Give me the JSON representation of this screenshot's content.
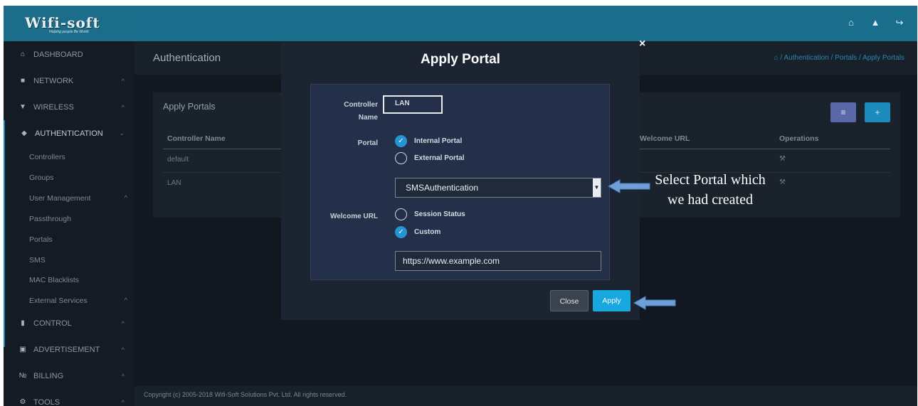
{
  "brand": {
    "logo_text": "Wifi-soft",
    "tagline": "Helping people Be World"
  },
  "header": {
    "icons": [
      "home-icon",
      "bell-icon",
      "logout-icon"
    ]
  },
  "sidebar": {
    "items": [
      {
        "label": "DASHBOARD",
        "icon": "home-icon"
      },
      {
        "label": "NETWORK",
        "icon": "monitor-icon"
      },
      {
        "label": "WIRELESS",
        "icon": "wifi-icon"
      },
      {
        "label": "AUTHENTICATION",
        "icon": "shield-icon"
      },
      {
        "label": "CONTROL",
        "icon": "database-icon"
      },
      {
        "label": "ADVERTISEMENT",
        "icon": "video-icon"
      },
      {
        "label": "BILLING",
        "icon": "billing-icon"
      },
      {
        "label": "TOOLS",
        "icon": "gear-icon"
      }
    ],
    "sub_items": [
      "Controllers",
      "Groups",
      "User Management",
      "Passthrough",
      "Portals",
      "SMS",
      "MAC Blacklists",
      "External Services"
    ]
  },
  "page": {
    "title": "Authentication",
    "breadcrumb": [
      "Authentication",
      "Portals",
      "Apply Portals"
    ]
  },
  "panel": {
    "title": "Apply Portals",
    "columns": [
      "Controller Name",
      "Welcome URL",
      "Operations"
    ],
    "rows": [
      {
        "controller": "default"
      },
      {
        "controller": "LAN"
      }
    ]
  },
  "modal": {
    "title": "Apply Portal",
    "close_symbol": "×",
    "controller_label_1": "Controller",
    "controller_label_2": "Name",
    "controller_value": "LAN",
    "portal_label": "Portal",
    "portal_options": [
      "Internal Portal",
      "External Portal"
    ],
    "portal_selected": "Internal Portal",
    "portal_select_value": "SMSAuthentication",
    "welcome_label": "Welcome URL",
    "welcome_options": [
      "Session Status",
      "Custom"
    ],
    "welcome_selected": "Custom",
    "welcome_url_value": "https://www.example.com",
    "close_button": "Close",
    "apply_button": "Apply"
  },
  "annotation": {
    "line1": "Select Portal which",
    "line2": "we had created",
    "arrow_color": "#6f9fd6"
  },
  "footer": {
    "text": "Copyright (c) 2005-2018 Wifi-Soft Solutions Pvt. Ltd. All rights reserved."
  },
  "colors": {
    "accent": "#1a6e8c",
    "apply": "#18a8e0",
    "radio_on": "#2494d2"
  }
}
